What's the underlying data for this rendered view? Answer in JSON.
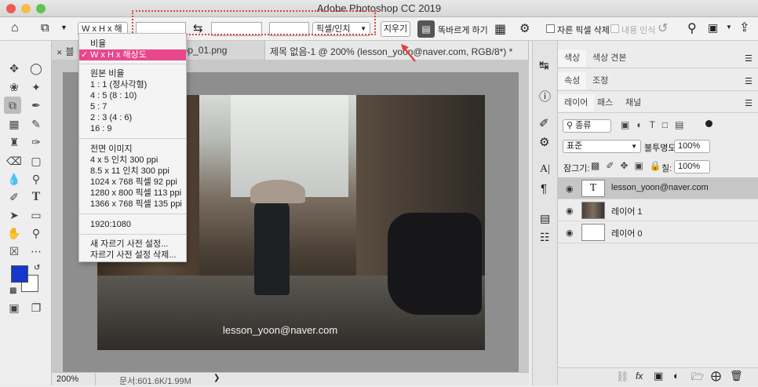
{
  "app": {
    "title": "Adobe Photoshop CC 2019"
  },
  "colors": {
    "highlight": "#e8478b",
    "annotation": "#e0433b",
    "foreground": "#1637c8",
    "background": "#ffffff"
  },
  "options_bar": {
    "ratio_select": "W x H x 해···",
    "unit_select": "픽셀/인치",
    "clear_button": "지우기",
    "straighten_label": "똑바르게 하기",
    "delete_cropped_label": "자른 픽셀 삭제",
    "content_aware_label": "내용 인식"
  },
  "tabs": {
    "tab1": "블",
    "tab2": "toshop_01.png",
    "tab3": "제목 없음-1 @ 200% (lesson_yoon@naver.com, RGB/8*) *"
  },
  "dropdown": {
    "ratio_header": "비율",
    "selected_item": "W x H x 해상도",
    "original_ratio": "원본 비율",
    "r1": "1 : 1 (정사각형)",
    "r2": "4 : 5 (8 : 10)",
    "r3": "5 : 7",
    "r4": "2 : 3 (4 : 6)",
    "r5": "16 : 9",
    "front_image": "전면 이미지",
    "s1": "4 x 5 인치 300 ppi",
    "s2": "8.5 x 11 인치 300 ppi",
    "s3": "1024 x 768 픽셀 92 ppi",
    "s4": "1280 x 800 픽셀 113 ppi",
    "s5": "1366 x 768 픽셀 135 ppi",
    "c1": "1920:1080",
    "new_preset": "새 자르기 사전 설정...",
    "delete_preset": "자르기 사전 설정 삭제..."
  },
  "canvas": {
    "watermark": "lesson_yoon@naver.com"
  },
  "status": {
    "zoom": "200%",
    "doc": "문서:601.6K/1.99M"
  },
  "panels": {
    "color_tab": "색상",
    "swatches_tab": "색상 견본",
    "properties_tab": "속성",
    "adjust_tab": "조정",
    "layers_tab": "레이어",
    "paths_tab": "패스",
    "channels_tab": "채널",
    "kind_select": "종류",
    "blend_select": "표준",
    "opacity_label": "불투명도:",
    "opacity_value": "100%",
    "lock_label": "잠그기:",
    "fill_label": "칠:",
    "fill_value": "100%"
  },
  "layers": [
    {
      "name": "lesson_yoon@naver.com",
      "type": "text"
    },
    {
      "name": "레이어 1",
      "type": "image"
    },
    {
      "name": "레이어 0",
      "type": "blank"
    }
  ]
}
